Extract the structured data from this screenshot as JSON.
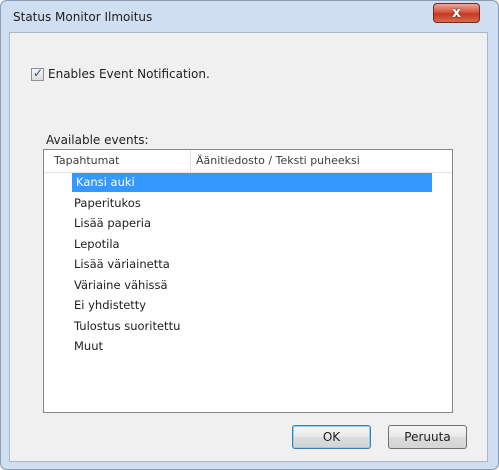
{
  "window": {
    "title": "Status Monitor Ilmoitus",
    "close_label": "x"
  },
  "notification": {
    "checkbox_label": "Enables Event Notification.",
    "checked": true
  },
  "events": {
    "section_label": "Available events:",
    "columns": [
      "Tapahtumat",
      "Äänitiedosto / Teksti puheeksi"
    ],
    "items": [
      {
        "label": "Kansi auki",
        "selected": true
      },
      {
        "label": "Paperitukos",
        "selected": false
      },
      {
        "label": "Lisää paperia",
        "selected": false
      },
      {
        "label": "Lepotila",
        "selected": false
      },
      {
        "label": "Lisää väriainetta",
        "selected": false
      },
      {
        "label": "Väriaine vähissä",
        "selected": false
      },
      {
        "label": "Ei yhdistetty",
        "selected": false
      },
      {
        "label": "Tulostus suoritettu",
        "selected": false
      },
      {
        "label": "Muut",
        "selected": false
      }
    ]
  },
  "buttons": {
    "ok": "OK",
    "cancel": "Peruuta"
  },
  "colors": {
    "selection": "#3399ff",
    "close_button": "#c94a31",
    "window_frame": "#cfdef0"
  }
}
